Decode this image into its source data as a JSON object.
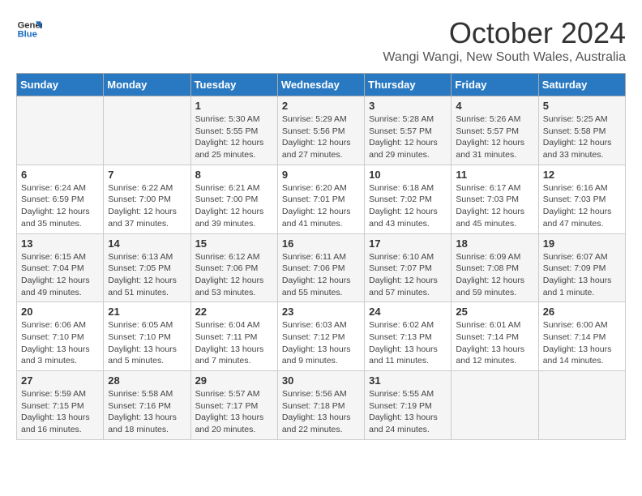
{
  "logo": {
    "line1": "General",
    "line2": "Blue"
  },
  "title": "October 2024",
  "subtitle": "Wangi Wangi, New South Wales, Australia",
  "days_header": [
    "Sunday",
    "Monday",
    "Tuesday",
    "Wednesday",
    "Thursday",
    "Friday",
    "Saturday"
  ],
  "weeks": [
    [
      {
        "day": "",
        "content": ""
      },
      {
        "day": "",
        "content": ""
      },
      {
        "day": "1",
        "content": "Sunrise: 5:30 AM\nSunset: 5:55 PM\nDaylight: 12 hours\nand 25 minutes."
      },
      {
        "day": "2",
        "content": "Sunrise: 5:29 AM\nSunset: 5:56 PM\nDaylight: 12 hours\nand 27 minutes."
      },
      {
        "day": "3",
        "content": "Sunrise: 5:28 AM\nSunset: 5:57 PM\nDaylight: 12 hours\nand 29 minutes."
      },
      {
        "day": "4",
        "content": "Sunrise: 5:26 AM\nSunset: 5:57 PM\nDaylight: 12 hours\nand 31 minutes."
      },
      {
        "day": "5",
        "content": "Sunrise: 5:25 AM\nSunset: 5:58 PM\nDaylight: 12 hours\nand 33 minutes."
      }
    ],
    [
      {
        "day": "6",
        "content": "Sunrise: 6:24 AM\nSunset: 6:59 PM\nDaylight: 12 hours\nand 35 minutes."
      },
      {
        "day": "7",
        "content": "Sunrise: 6:22 AM\nSunset: 7:00 PM\nDaylight: 12 hours\nand 37 minutes."
      },
      {
        "day": "8",
        "content": "Sunrise: 6:21 AM\nSunset: 7:00 PM\nDaylight: 12 hours\nand 39 minutes."
      },
      {
        "day": "9",
        "content": "Sunrise: 6:20 AM\nSunset: 7:01 PM\nDaylight: 12 hours\nand 41 minutes."
      },
      {
        "day": "10",
        "content": "Sunrise: 6:18 AM\nSunset: 7:02 PM\nDaylight: 12 hours\nand 43 minutes."
      },
      {
        "day": "11",
        "content": "Sunrise: 6:17 AM\nSunset: 7:03 PM\nDaylight: 12 hours\nand 45 minutes."
      },
      {
        "day": "12",
        "content": "Sunrise: 6:16 AM\nSunset: 7:03 PM\nDaylight: 12 hours\nand 47 minutes."
      }
    ],
    [
      {
        "day": "13",
        "content": "Sunrise: 6:15 AM\nSunset: 7:04 PM\nDaylight: 12 hours\nand 49 minutes."
      },
      {
        "day": "14",
        "content": "Sunrise: 6:13 AM\nSunset: 7:05 PM\nDaylight: 12 hours\nand 51 minutes."
      },
      {
        "day": "15",
        "content": "Sunrise: 6:12 AM\nSunset: 7:06 PM\nDaylight: 12 hours\nand 53 minutes."
      },
      {
        "day": "16",
        "content": "Sunrise: 6:11 AM\nSunset: 7:06 PM\nDaylight: 12 hours\nand 55 minutes."
      },
      {
        "day": "17",
        "content": "Sunrise: 6:10 AM\nSunset: 7:07 PM\nDaylight: 12 hours\nand 57 minutes."
      },
      {
        "day": "18",
        "content": "Sunrise: 6:09 AM\nSunset: 7:08 PM\nDaylight: 12 hours\nand 59 minutes."
      },
      {
        "day": "19",
        "content": "Sunrise: 6:07 AM\nSunset: 7:09 PM\nDaylight: 13 hours\nand 1 minute."
      }
    ],
    [
      {
        "day": "20",
        "content": "Sunrise: 6:06 AM\nSunset: 7:10 PM\nDaylight: 13 hours\nand 3 minutes."
      },
      {
        "day": "21",
        "content": "Sunrise: 6:05 AM\nSunset: 7:10 PM\nDaylight: 13 hours\nand 5 minutes."
      },
      {
        "day": "22",
        "content": "Sunrise: 6:04 AM\nSunset: 7:11 PM\nDaylight: 13 hours\nand 7 minutes."
      },
      {
        "day": "23",
        "content": "Sunrise: 6:03 AM\nSunset: 7:12 PM\nDaylight: 13 hours\nand 9 minutes."
      },
      {
        "day": "24",
        "content": "Sunrise: 6:02 AM\nSunset: 7:13 PM\nDaylight: 13 hours\nand 11 minutes."
      },
      {
        "day": "25",
        "content": "Sunrise: 6:01 AM\nSunset: 7:14 PM\nDaylight: 13 hours\nand 12 minutes."
      },
      {
        "day": "26",
        "content": "Sunrise: 6:00 AM\nSunset: 7:14 PM\nDaylight: 13 hours\nand 14 minutes."
      }
    ],
    [
      {
        "day": "27",
        "content": "Sunrise: 5:59 AM\nSunset: 7:15 PM\nDaylight: 13 hours\nand 16 minutes."
      },
      {
        "day": "28",
        "content": "Sunrise: 5:58 AM\nSunset: 7:16 PM\nDaylight: 13 hours\nand 18 minutes."
      },
      {
        "day": "29",
        "content": "Sunrise: 5:57 AM\nSunset: 7:17 PM\nDaylight: 13 hours\nand 20 minutes."
      },
      {
        "day": "30",
        "content": "Sunrise: 5:56 AM\nSunset: 7:18 PM\nDaylight: 13 hours\nand 22 minutes."
      },
      {
        "day": "31",
        "content": "Sunrise: 5:55 AM\nSunset: 7:19 PM\nDaylight: 13 hours\nand 24 minutes."
      },
      {
        "day": "",
        "content": ""
      },
      {
        "day": "",
        "content": ""
      }
    ]
  ]
}
